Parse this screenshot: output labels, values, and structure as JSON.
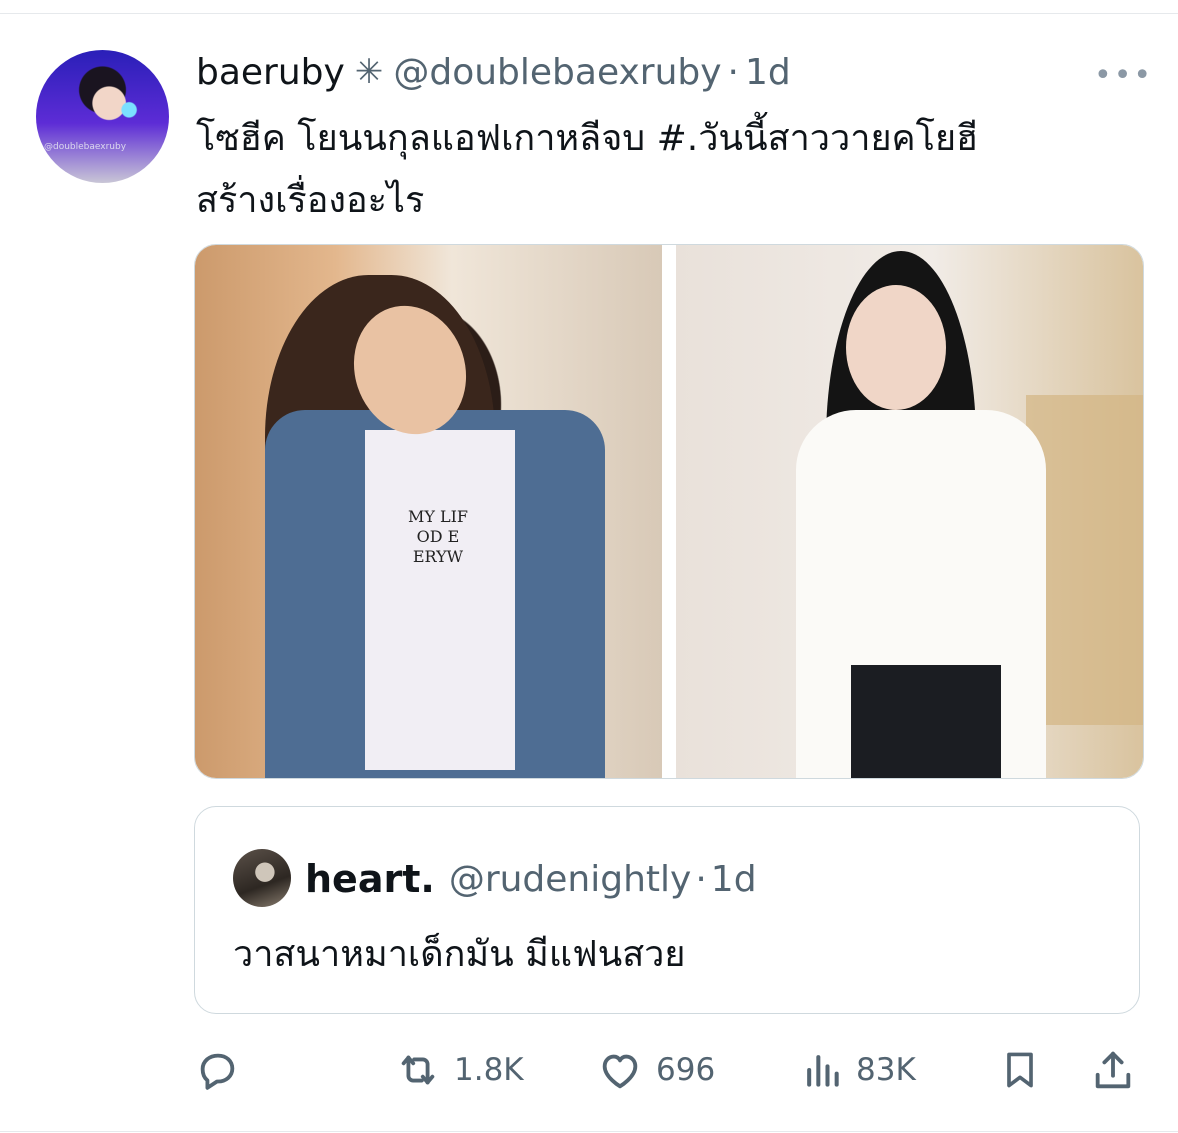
{
  "tweet": {
    "display_name": "baeruby",
    "name_badge": "✳",
    "handle": "@doublebaexruby",
    "separator": "·",
    "time": "1d",
    "more": "•••",
    "avatar_watermark": "@doublebaexruby",
    "text_line1": "โซฮีค โยนนกุลแอฟเกาหลีจบ #.วันนี้สาววายคโยฮี",
    "text_line2": "สร้างเรื่องอะไร",
    "media_shirt_print": [
      "MY LIF",
      "OD E",
      "ERYW"
    ]
  },
  "quote": {
    "display_name": "heart.",
    "handle": "@rudenightly",
    "separator": "·",
    "time": "1d",
    "text": "วาสนาหมาเด็กมัน มีแฟนสวย"
  },
  "actions": {
    "reply_count": "",
    "repost_count": "1.8K",
    "like_count": "696",
    "views_count": "83K"
  },
  "colors": {
    "text": "#0f1419",
    "secondary": "#536471",
    "border": "#cfd9de"
  }
}
